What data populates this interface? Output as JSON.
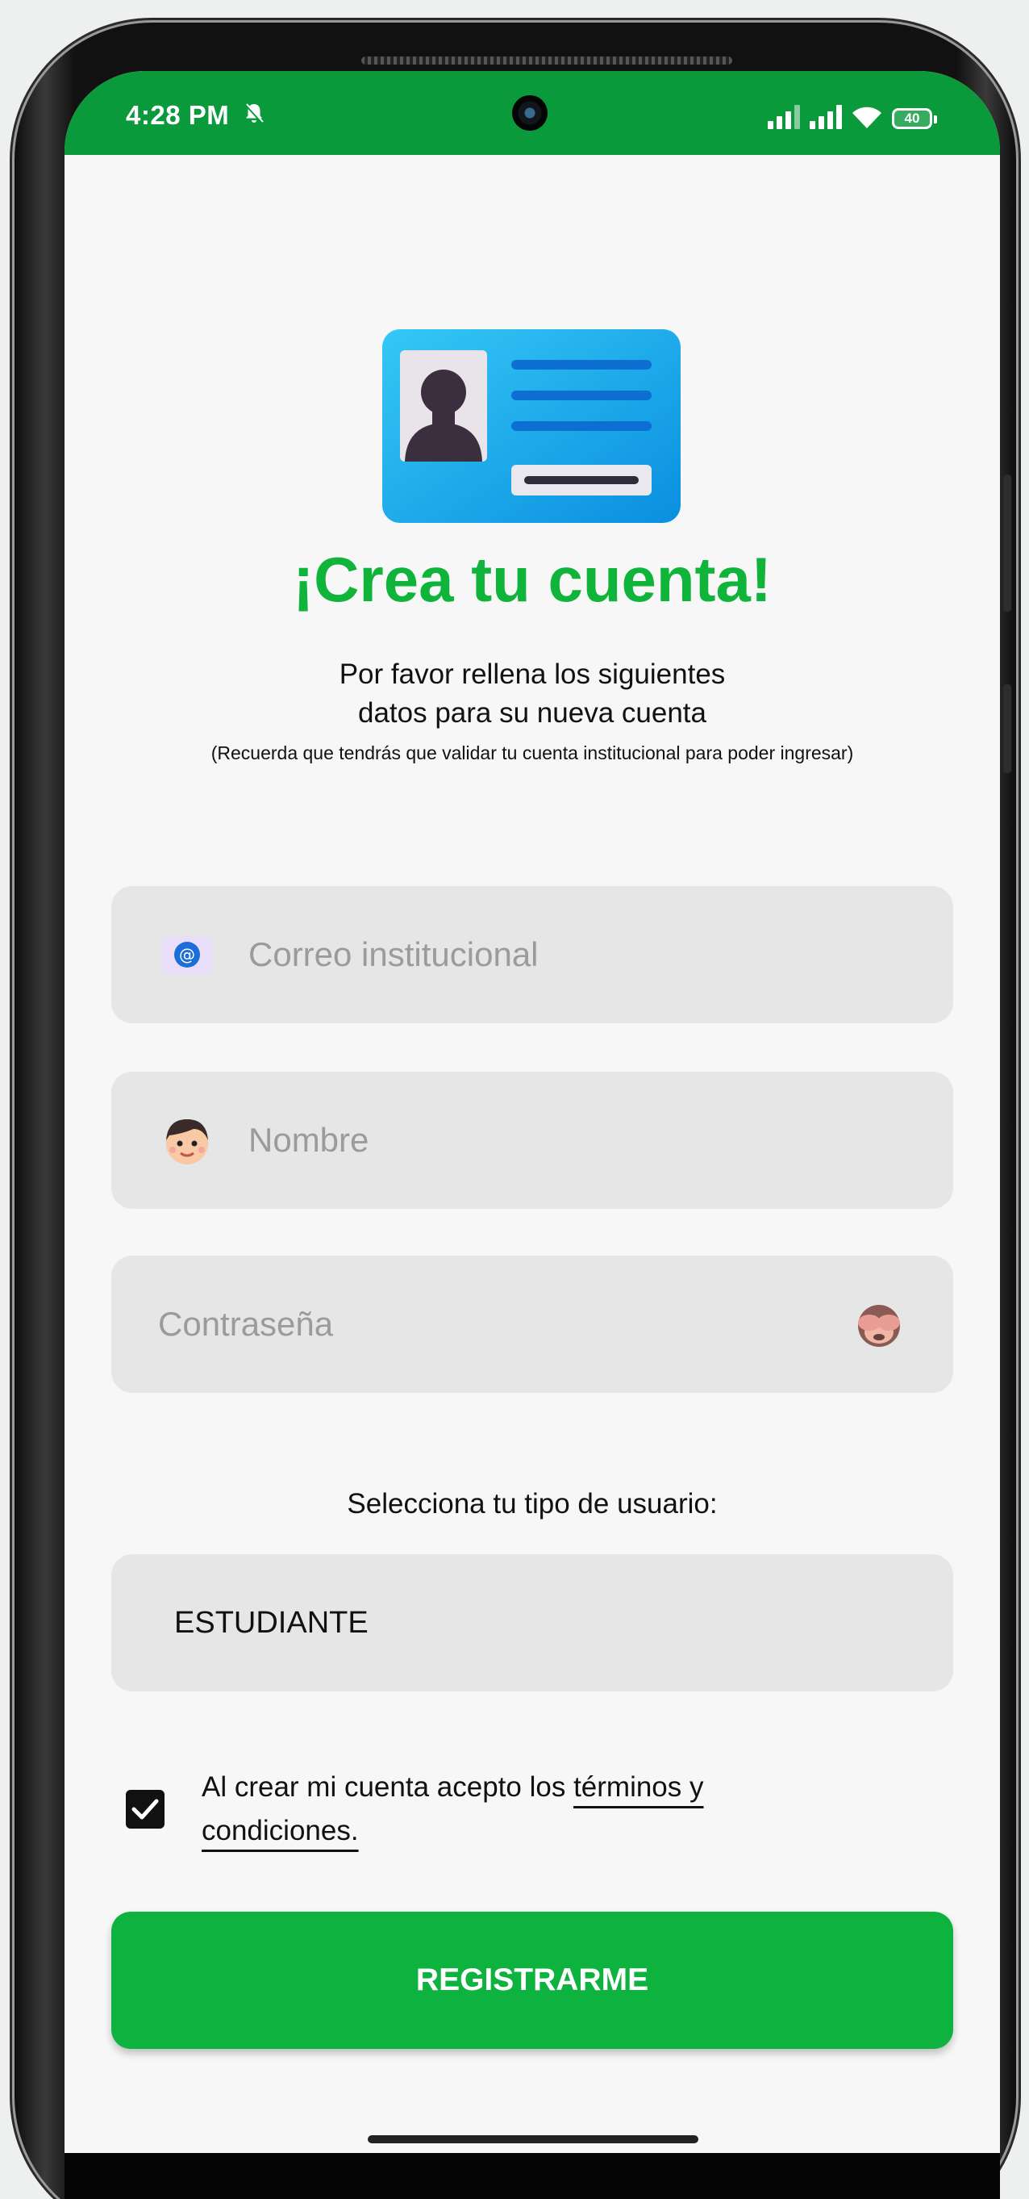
{
  "status_bar": {
    "time": "4:28 PM",
    "battery": "40",
    "background_color": "#0a9a3c"
  },
  "icons": {
    "bell": "bell-mute-icon",
    "camera": "front-camera-icon",
    "signal": "cellular-signal-icon",
    "wifi": "wifi-icon",
    "battery": "battery-icon",
    "id_card": "id-card-icon",
    "email": "email-at-icon",
    "name": "person-face-icon",
    "password": "see-no-evil-monkey-icon",
    "checkbox": "checkmark-icon"
  },
  "header": {
    "title": "¡Crea tu cuenta!",
    "subtitle_line1": "Por favor rellena los siguientes",
    "subtitle_line2": "datos para su nueva cuenta",
    "note": "(Recuerda que tendrás que validar tu cuenta institucional para poder ingresar)"
  },
  "form": {
    "email_placeholder": "Correo institucional",
    "name_placeholder": "Nombre",
    "password_placeholder": "Contraseña",
    "user_type_label": "Selecciona tu tipo de usuario:",
    "user_type_value": "ESTUDIANTE",
    "terms_prefix": "Al crear mi cuenta acepto los ",
    "terms_link": "términos y condiciones.",
    "terms_checked": true,
    "submit_label": "REGISTRARME"
  },
  "colors": {
    "accent": "#10b43b",
    "button": "#0db33e",
    "field_background": "#e6e6e6",
    "screen_background": "#f7f7f7"
  }
}
